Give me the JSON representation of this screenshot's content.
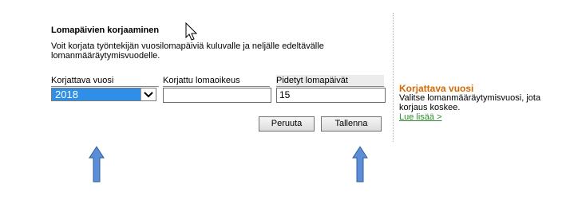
{
  "form": {
    "title": "Lomapäivien korjaaminen",
    "description": "Voit korjata työntekijän vuosilomapäiviä kuluvalle ja neljälle edeltävälle lomanmääräytymisvuodelle.",
    "columns": {
      "year_label": "Korjattava vuosi",
      "correction_label": "Korjattu lomaoikeus",
      "days_label": "Pidetyt lomapäivät"
    },
    "year_value": "2018",
    "correction_value": "",
    "days_value": "15",
    "cancel_label": "Peruuta",
    "save_label": "Tallenna"
  },
  "help": {
    "title": "Korjattava vuosi",
    "text": "Valitse lomanmääräytymisvuosi, jota korjaus koskee.",
    "link": "Lue lisää >"
  },
  "colors": {
    "select_highlight": "#2f8fe6",
    "help_title": "#d56a00",
    "link": "#2e8b2e",
    "arrow_fill": "#5b8ed6"
  },
  "icons": {
    "cursor": "mouse-pointer-icon",
    "arrows": "arrow-up-icon"
  }
}
